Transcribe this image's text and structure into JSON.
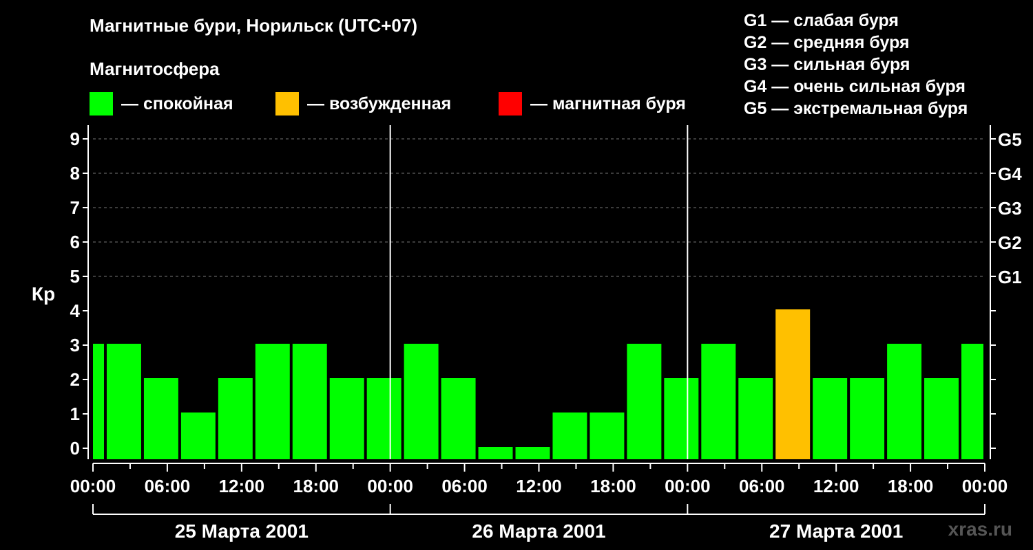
{
  "chart_data": {
    "type": "bar",
    "title": "Магнитные бури, Норильск (UTC+07)",
    "subtitle": "Магнитосфера",
    "ylabel": "Кр",
    "ylim": [
      0,
      9
    ],
    "yticks": [
      "0",
      "1",
      "2",
      "3",
      "4",
      "5",
      "6",
      "7",
      "8",
      "9"
    ],
    "right_ticks": [
      {
        "value": 5,
        "label": "G1"
      },
      {
        "value": 6,
        "label": "G2"
      },
      {
        "value": 7,
        "label": "G3"
      },
      {
        "value": 8,
        "label": "G4"
      },
      {
        "value": 9,
        "label": "G5"
      }
    ],
    "legend": [
      {
        "label": "— спокойная",
        "color": "#00ff00"
      },
      {
        "label": "— возбужденная",
        "color": "#ffc000"
      },
      {
        "label": "— магнитная буря",
        "color": "#ff0000"
      }
    ],
    "storm_scale": [
      "G1 — слабая буря",
      "G2 — средняя буря",
      "G3 — сильная буря",
      "G4 — очень сильная буря",
      "G5 — экстремальная буря"
    ],
    "xticks": [
      "00:00",
      "06:00",
      "12:00",
      "18:00",
      "00:00",
      "06:00",
      "12:00",
      "18:00",
      "00:00",
      "06:00",
      "12:00",
      "18:00",
      "00:00"
    ],
    "days": [
      "25 Марта 2001",
      "26 Марта 2001",
      "27 Марта 2001"
    ],
    "bars": [
      {
        "start_hour": 0,
        "end_hour": 1,
        "value": 3,
        "status": "calm"
      },
      {
        "start_hour": 1,
        "end_hour": 4,
        "value": 3,
        "status": "calm"
      },
      {
        "start_hour": 4,
        "end_hour": 7,
        "value": 2,
        "status": "calm"
      },
      {
        "start_hour": 7,
        "end_hour": 10,
        "value": 1,
        "status": "calm"
      },
      {
        "start_hour": 10,
        "end_hour": 13,
        "value": 2,
        "status": "calm"
      },
      {
        "start_hour": 13,
        "end_hour": 16,
        "value": 3,
        "status": "calm"
      },
      {
        "start_hour": 16,
        "end_hour": 19,
        "value": 3,
        "status": "calm"
      },
      {
        "start_hour": 19,
        "end_hour": 22,
        "value": 2,
        "status": "calm"
      },
      {
        "start_hour": 22,
        "end_hour": 25,
        "value": 2,
        "status": "calm"
      },
      {
        "start_hour": 25,
        "end_hour": 28,
        "value": 3,
        "status": "calm"
      },
      {
        "start_hour": 28,
        "end_hour": 31,
        "value": 2,
        "status": "calm"
      },
      {
        "start_hour": 31,
        "end_hour": 34,
        "value": 0,
        "status": "calm"
      },
      {
        "start_hour": 34,
        "end_hour": 37,
        "value": 0,
        "status": "calm"
      },
      {
        "start_hour": 37,
        "end_hour": 40,
        "value": 1,
        "status": "calm"
      },
      {
        "start_hour": 40,
        "end_hour": 43,
        "value": 1,
        "status": "calm"
      },
      {
        "start_hour": 43,
        "end_hour": 46,
        "value": 3,
        "status": "calm"
      },
      {
        "start_hour": 46,
        "end_hour": 49,
        "value": 2,
        "status": "calm"
      },
      {
        "start_hour": 49,
        "end_hour": 52,
        "value": 3,
        "status": "calm"
      },
      {
        "start_hour": 52,
        "end_hour": 55,
        "value": 2,
        "status": "calm"
      },
      {
        "start_hour": 55,
        "end_hour": 58,
        "value": 4,
        "status": "excited"
      },
      {
        "start_hour": 58,
        "end_hour": 61,
        "value": 2,
        "status": "calm"
      },
      {
        "start_hour": 61,
        "end_hour": 64,
        "value": 2,
        "status": "calm"
      },
      {
        "start_hour": 64,
        "end_hour": 67,
        "value": 3,
        "status": "calm"
      },
      {
        "start_hour": 67,
        "end_hour": 70,
        "value": 2,
        "status": "calm"
      },
      {
        "start_hour": 70,
        "end_hour": 72,
        "value": 3,
        "status": "calm"
      }
    ],
    "colors": {
      "calm": "#00ff00",
      "excited": "#ffc000",
      "storm": "#ff0000"
    },
    "grid": true
  },
  "watermark": "xras.ru"
}
